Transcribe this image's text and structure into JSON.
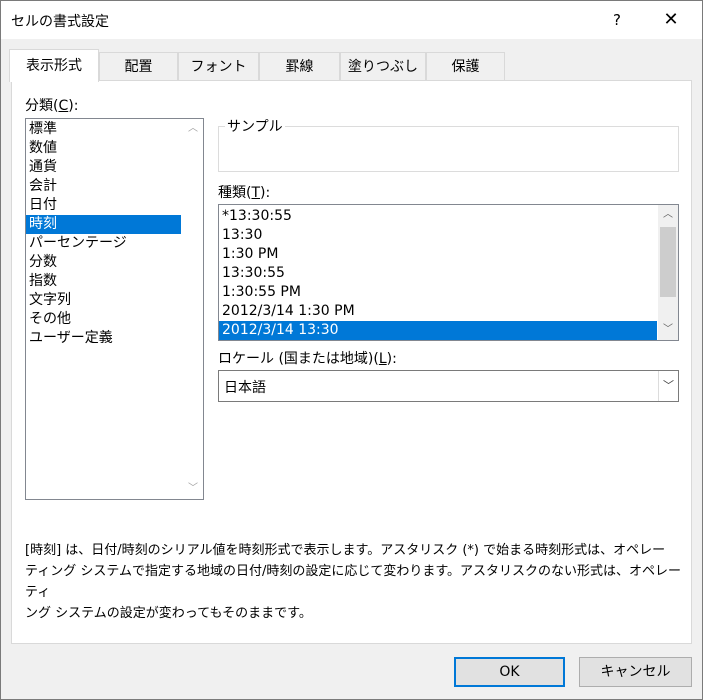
{
  "window": {
    "title": "セルの書式設定",
    "help_label": "?",
    "close_label": "✕"
  },
  "tabs": [
    {
      "label": "表示形式"
    },
    {
      "label": "配置"
    },
    {
      "label": "フォント"
    },
    {
      "label": "罫線"
    },
    {
      "label": "塗りつぶし"
    },
    {
      "label": "保護"
    }
  ],
  "category": {
    "label_prefix": "分類(",
    "label_key": "C",
    "label_suffix": "):",
    "items": [
      "標準",
      "数値",
      "通貨",
      "会計",
      "日付",
      "時刻",
      "パーセンテージ",
      "分数",
      "指数",
      "文字列",
      "その他",
      "ユーザー定義"
    ],
    "selected": "時刻"
  },
  "sample": {
    "label": "サンプル",
    "value": ""
  },
  "type": {
    "label_prefix": "種類(",
    "label_key": "T",
    "label_suffix": "):",
    "items": [
      "*13:30:55",
      "13:30",
      "1:30 PM",
      "13:30:55",
      "1:30:55 PM",
      "2012/3/14 1:30 PM",
      "2012/3/14 13:30"
    ],
    "selected": "2012/3/14 13:30"
  },
  "locale": {
    "label_prefix": "ロケール (国または地域)(",
    "label_key": "L",
    "label_suffix": "):",
    "value": "日本語"
  },
  "description": {
    "line1": "[時刻] は、日付/時刻のシリアル値を時刻形式で表示します。アスタリスク (*) で始まる時刻形式は、オペレー",
    "line2": "ティング システムで指定する地域の日付/時刻の設定に応じて変わります。アスタリスクのない形式は、オペレーティ",
    "line3": "ング システムの設定が変わってもそのままです。"
  },
  "buttons": {
    "ok": "OK",
    "cancel": "キャンセル"
  },
  "icons": {
    "scroll_up": "chevron-up-icon",
    "scroll_down": "chevron-down-icon",
    "combo_dropdown": "chevron-down-icon"
  },
  "colors": {
    "selection": "#0078d7",
    "default_button_border": "#0078d7"
  }
}
